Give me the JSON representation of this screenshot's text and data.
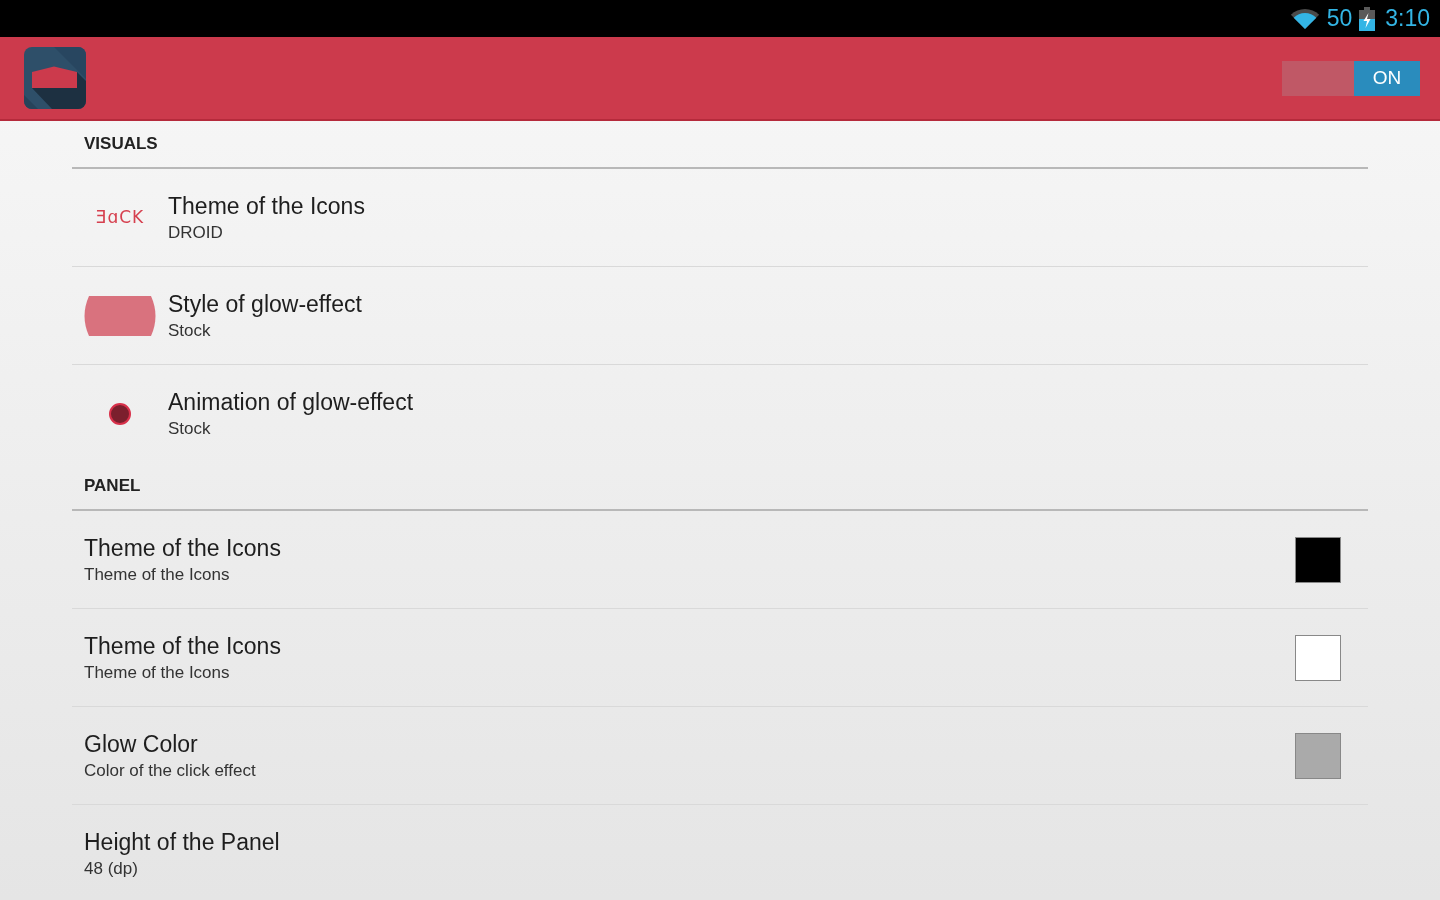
{
  "status_bar": {
    "battery_percent": "50",
    "time": "3:10"
  },
  "app_bar": {
    "switch": {
      "label": "ON",
      "on": true
    }
  },
  "sections": [
    {
      "header": "VISUALS",
      "items": [
        {
          "kind": "text_icon",
          "icon_text": "ƎɑCK",
          "title": "Theme of the Icons",
          "summary": "DROID"
        },
        {
          "kind": "glow_style",
          "title": "Style of glow-effect",
          "summary": "Stock"
        },
        {
          "kind": "glow_animation",
          "title": "Animation of glow-effect",
          "summary": "Stock"
        }
      ]
    },
    {
      "header": "PANEL",
      "items": [
        {
          "kind": "color",
          "color": "#000000",
          "title": "Theme of the Icons",
          "summary": "Theme of the Icons"
        },
        {
          "kind": "color",
          "color": "#ffffff",
          "title": "Theme of the Icons",
          "summary": "Theme of the Icons"
        },
        {
          "kind": "color",
          "color": "#aaaaaa",
          "title": "Glow Color",
          "summary": "Color of the click effect"
        },
        {
          "kind": "plain",
          "title": "Height of the Panel",
          "summary": "48 (dp)"
        }
      ]
    }
  ]
}
